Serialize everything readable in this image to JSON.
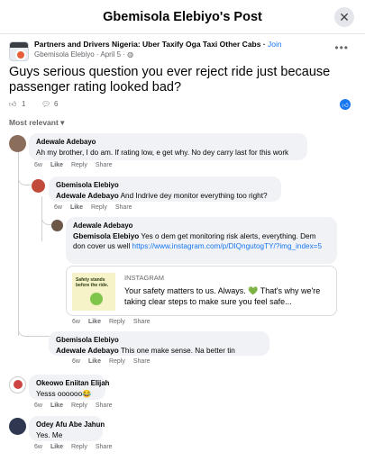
{
  "header": {
    "title": "Gbemisola Elebiyo's Post",
    "close": "✕"
  },
  "post": {
    "group": "Partners and Drivers Nigeria: Uber Taxify Oga Taxi Other Cabs",
    "join": "Join",
    "author_line": "Gbemisola Elebiyo · April 5 · ",
    "text": "Guys serious question you ever reject ride just because passenger rating looked bad?",
    "likes": "1",
    "comments": "6",
    "sort_label": "Most relevant ▾"
  },
  "comments": [
    {
      "name": "Adewale Adebayo",
      "text": "Ah my brother, I do am. If rating low, e get why. No dey carry last for this work",
      "time": "6w",
      "like": "Like",
      "reply": "Reply",
      "share": "Share"
    },
    {
      "name": "Gbemisola Elebiyo",
      "mention": "Adewale Adebayo",
      "text": " And Indrive dey monitor everything too right?",
      "time": "6w",
      "like": "Like",
      "reply": "Reply",
      "share": "Share"
    },
    {
      "name": "Adewale Adebayo",
      "mention": "Gbemisola Elebiyo",
      "text": " Yes o dem get monitoring risk alerts, everything. Dem don cover us well ",
      "link": "https://www.instagram.com/p/DIQngutogTY/?img_index=5",
      "card": {
        "thumb_text": "Safety stands before the ride.",
        "source": "INSTAGRAM",
        "title": "Your safety matters to us. Always. 💚 That's why we're taking clear steps to make sure you feel safe..."
      },
      "time": "6w",
      "like": "Like",
      "reply": "Reply",
      "share": "Share"
    },
    {
      "name": "Gbemisola Elebiyo",
      "mention": "Adewale Adebayo",
      "text": " This one make sense. Na better tin",
      "time": "6w",
      "like": "Like",
      "reply": "Reply",
      "share": "Share"
    },
    {
      "name": "Okeowo Eniitan Elijah",
      "text": "Yesss oooooo😂",
      "time": "6w",
      "like": "Like",
      "reply": "Reply",
      "share": "Share"
    },
    {
      "name": "Odey Afu Abe Jahun",
      "text": "Yes. Me",
      "time": "6w",
      "like": "Like",
      "reply": "Reply",
      "share": "Share"
    }
  ],
  "colors": {
    "accent": "#1877f2",
    "bubble": "#f0f2f5",
    "muted": "#65676b"
  }
}
